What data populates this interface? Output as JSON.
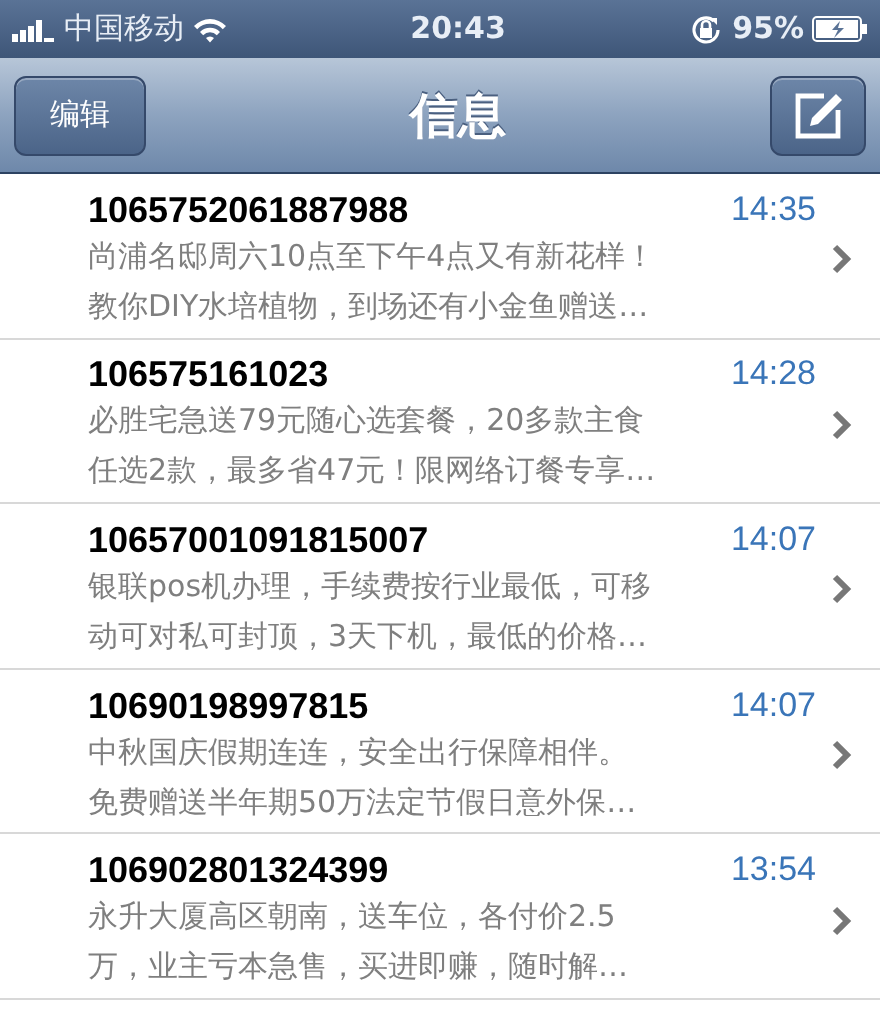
{
  "status_bar": {
    "carrier": "中国移动",
    "time": "20:43",
    "battery": "95%"
  },
  "nav_bar": {
    "left_button": "编辑",
    "title": "信息"
  },
  "messages": [
    {
      "sender": "1065752061887988",
      "time": "14:35",
      "preview_lines": [
        "尚浦名邸周六10点至下午4点又有新花样！",
        "教你DIY水培植物，到场还有小金鱼赠送…"
      ]
    },
    {
      "sender": "106575161023",
      "time": "14:28",
      "preview_lines": [
        "必胜宅急送79元随心选套餐，20多款主食",
        "任选2款，最多省47元！限网络订餐专享…"
      ]
    },
    {
      "sender": "10657001091815007",
      "time": "14:07",
      "preview_lines": [
        "银联pos机办理，手续费按行业最低，可移",
        "动可对私可封顶，3天下机，最低的价格…"
      ]
    },
    {
      "sender": "10690198997815",
      "time": "14:07",
      "preview_lines": [
        "中秋国庆假期连连，安全出行保障相伴。",
        "免费赠送半年期50万法定节假日意外保…"
      ]
    },
    {
      "sender": "106902801324399",
      "time": "13:54",
      "preview_lines": [
        "永升大厦高区朝南，送车位，各付价2.5",
        "万，业主亏本急售，买进即赚，随时解…"
      ]
    }
  ]
}
